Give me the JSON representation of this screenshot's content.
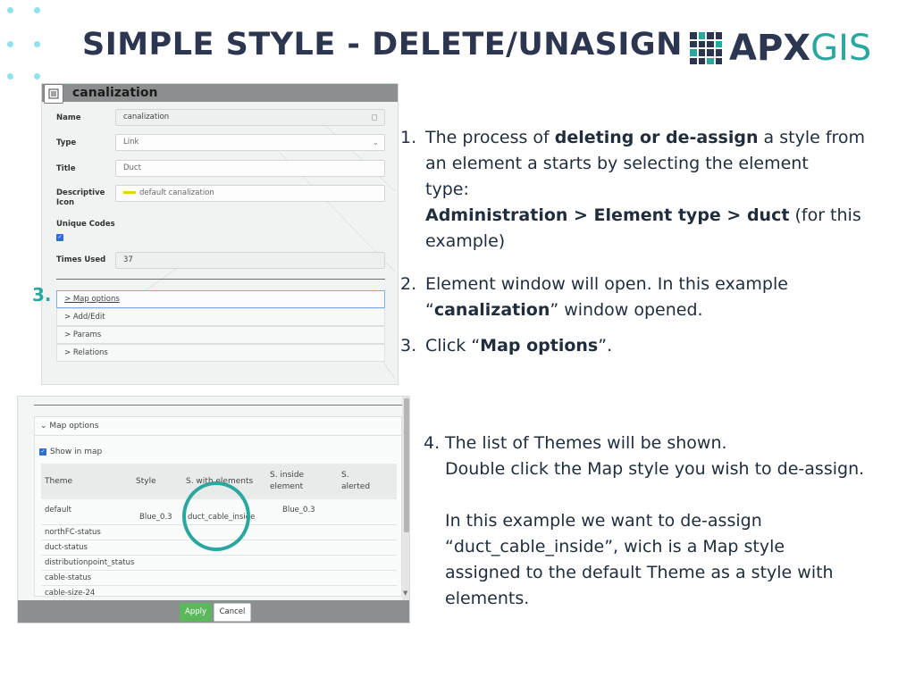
{
  "slide": {
    "title": "SIMPLE STYLE - DELETE/UNASIGN",
    "logo_apx": "APX",
    "logo_gis": "GIS"
  },
  "element_window": {
    "title": "canalization",
    "fields": {
      "name_label": "Name",
      "name_value": "canalization",
      "type_label": "Type",
      "type_value": "Link",
      "title_label": "Title",
      "title_value": "Duct",
      "icon_label": "Descriptive Icon",
      "icon_value": "default canalization",
      "unique_label": "Unique Codes",
      "times_label": "Times Used",
      "times_value": "37"
    },
    "accordion": {
      "map_options": "> Map options",
      "add_edit": "> Add/Edit",
      "params": "> Params",
      "relations": "> Relations"
    },
    "step_marker": "3."
  },
  "steps": {
    "s1_num": "1.",
    "s1_a": "The process of ",
    "s1_b": "deleting  or de-assign",
    "s1_c": " a style from",
    "s1_d": "an element a starts by selecting the element",
    "s1_e": "type:",
    "s1_f": "Administration > Element type > duct",
    "s1_g": " (for this",
    "s1_h": "example)",
    "s2_num": "2.",
    "s2_a": "Element window will open. In this example",
    "s2_b": "“",
    "s2_c": "canalization",
    "s2_d": "” window opened.",
    "s3_num": "3.",
    "s3_a": "Click “",
    "s3_b": "Map options",
    "s3_c": "”.",
    "s4_num": "4.",
    "s4_a": "The list of Themes will be shown.",
    "s4_b": "Double click the Map style you wish to de-assign.",
    "s4_c": "In this example we want to de-assign",
    "s4_d": "“duct_cable_inside”, wich is a Map style",
    "s4_e": "assigned to the default Theme as a style with",
    "s4_f": "elements."
  },
  "map_options": {
    "header": "Map options",
    "show_in_map": "Show in map",
    "columns": {
      "theme": "Theme",
      "style": "Style",
      "s_with_elements": "S. with elements",
      "s_inside_1": "S. inside",
      "s_inside_2": "element",
      "s_alerted_1": "S.",
      "s_alerted_2": "alerted"
    },
    "rows": [
      {
        "theme": "default",
        "style": "Blue_0.3",
        "s_with": "duct_cable_inside",
        "s_inside": "Blue_0.3"
      },
      {
        "theme": "northFC-status"
      },
      {
        "theme": "duct-status"
      },
      {
        "theme": "distributionpoint_status"
      },
      {
        "theme": "cable-status"
      },
      {
        "theme": "cable-size-24"
      }
    ],
    "apply": "Apply",
    "cancel": "Cancel"
  }
}
